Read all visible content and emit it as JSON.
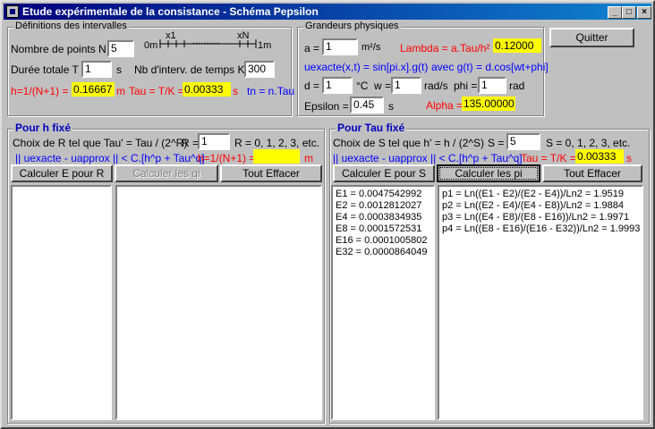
{
  "window": {
    "title": "Etude expérimentale de la consistance - Schéma Pepsilon",
    "min": "_",
    "max": "□",
    "close": "×"
  },
  "intervals": {
    "group_label": "Définitions des intervalles",
    "n_label": "Nombre de points  N =",
    "n_value": "5",
    "x_start": "0m",
    "x1": "x1",
    "dots": "..........",
    "xN": "xN",
    "x_end": "1m",
    "t_label": "Durée totale T =",
    "t_value": "1",
    "t_unit": "s",
    "k_label": "Nb d'interv. de temps K =",
    "k_value": "300",
    "h_label": "h=1/(N+1) =",
    "h_value": "0.16667",
    "h_unit": "m",
    "tau_label": "Tau = T/K =",
    "tau_value": "0.00333",
    "tau_unit": "s",
    "tn_label": "tn = n.Tau"
  },
  "physics": {
    "group_label": "Grandeurs physiques",
    "a_label": "a =",
    "a_value": "1",
    "a_unit": "m²/s",
    "lambda_label": "Lambda = a.Tau/h² =",
    "lambda_value": "0.12000",
    "uexacte_label": "uexacte(x,t) = sin[pi.x].g(t)",
    "g_label": "avec g(t) = d.cos[wt+phi]",
    "d_label": "d =",
    "d_value": "1",
    "d_unit": "°C",
    "w_label": "w =",
    "w_value": "1",
    "w_unit": "rad/s",
    "phi_label": "phi =",
    "phi_value": "1",
    "phi_unit": "rad",
    "eps_label": "Epsilon =",
    "eps_value": "0.45",
    "eps_unit": "s",
    "alpha_label": "Alpha =",
    "alpha_value": "135.00000"
  },
  "quit_label": "Quitter",
  "h_fixed": {
    "title": "Pour h fixé",
    "choice_label": "Choix de R tel que Tau' = Tau / (2^R)",
    "r_label": "R =",
    "r_value": "1",
    "r_values": "R = 0, 1, 2, 3, etc.",
    "norm_label": "|| uexacte - uapprox || < C.[h^p + Tau^q]",
    "h_label": "h=1/(N+1) =",
    "h_value": "",
    "h_unit": "m",
    "btn_calc": "Calculer E pour R",
    "btn_qi": "Calculer les qi",
    "btn_clear": "Tout Effacer",
    "list_e": [],
    "list_q": []
  },
  "tau_fixed": {
    "title": "Pour Tau fixé",
    "choice_label": "Choix de S tel que h' = h / (2^S)",
    "s_label": "S =",
    "s_value": "5",
    "s_values": "S = 0, 1, 2, 3, etc.",
    "norm_label": "|| uexacte - uapprox || < C.[h^p + Tau^q]",
    "tau_label": "Tau = T/K =",
    "tau_value": "0.00333",
    "tau_unit": "s",
    "btn_calc": "Calculer E pour S",
    "btn_pi": "Calculer les pi",
    "btn_clear": "Tout Effacer",
    "list_e": [
      "E1 = 0.0047542992",
      "E2 = 0.0012812027",
      "E4 = 0.0003834935",
      "E8 = 0.0001572531",
      "E16 = 0.0001005802",
      "E32 = 0.0000864049"
    ],
    "list_p": [
      "p1 = Ln((E1 - E2)/(E2 - E4))/Ln2 = 1.9519",
      "p2 = Ln((E2 - E4)/(E4 - E8))/Ln2 = 1.9884",
      "p3 = Ln((E4 - E8)/(E8 - E16))/Ln2 = 1.9971",
      "p4 = Ln((E8 - E16)/(E16 - E32))/Ln2 = 1.9993"
    ]
  }
}
